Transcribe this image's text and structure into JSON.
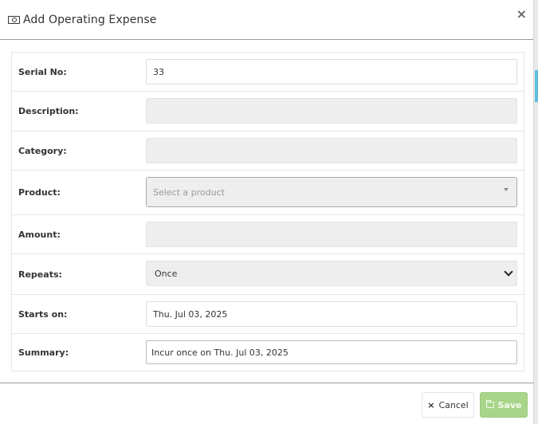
{
  "modal": {
    "title": "Add Operating Expense",
    "close_glyph": "×"
  },
  "form": {
    "serial_no": {
      "label": "Serial No:",
      "value": "33"
    },
    "description": {
      "label": "Description:",
      "value": ""
    },
    "category": {
      "label": "Category:",
      "value": ""
    },
    "product": {
      "label": "Product:",
      "placeholder": "Select a product"
    },
    "amount": {
      "label": "Amount:",
      "value": ""
    },
    "repeats": {
      "label": "Repeats:",
      "value": "Once"
    },
    "starts_on": {
      "label": "Starts on:",
      "value": "Thu. Jul 03, 2025"
    },
    "summary": {
      "label": "Summary:",
      "value": "Incur once on Thu. Jul 03, 2025"
    }
  },
  "footer": {
    "cancel_label": "Cancel",
    "cancel_icon": "×",
    "save_label": "Save"
  },
  "colors": {
    "save_button": "#a8d58a",
    "page_accent": "#5bc0de"
  },
  "icons": {
    "title": "cash-icon",
    "close": "close-icon",
    "product_dropdown": "caret-down-icon",
    "repeats_dropdown": "chevron-down-icon",
    "cancel": "times-icon",
    "save": "folder-icon"
  }
}
